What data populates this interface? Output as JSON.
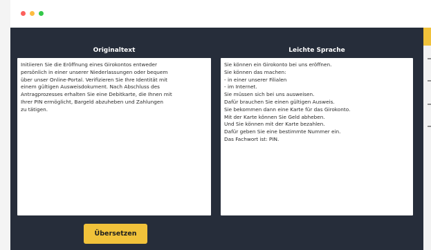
{
  "window": {
    "controls": [
      "close",
      "minimize",
      "maximize"
    ],
    "colors": {
      "close": "#fc605c",
      "minimize": "#fdbc40",
      "maximize": "#34c84a"
    }
  },
  "original": {
    "title": "Originaltext",
    "lines": [
      "Initiieren Sie die Eröffnung eines Girokontos entweder",
      "persönlich in einer unserer Niederlassungen oder bequem",
      "über unser Online-Portal. Verifizieren Sie Ihre Identität mit",
      "einem gültigen Ausweisdokument. Nach Abschluss des",
      "Antragprozesses erhalten Sie eine Debitkarte, die Ihnen mit",
      "Ihrer PIN ermöglicht, Bargeld abzuheben und Zahlungen",
      "zu tätigen."
    ]
  },
  "simple": {
    "title": "Leichte Sprache",
    "lines": [
      "Sie können ein Girokonto bei uns eröffnen.",
      "Sie können das machen:",
      "- in einer unserer Filialen",
      "- im Internet.",
      "Sie müssen sich bei uns ausweisen.",
      "Dafür brauchen Sie einen gültigen Ausweis.",
      "Sie bekommen dann eine Karte für das Girokonto.",
      "Mit der Karte können Sie Geld abheben.",
      "Und Sie können mit der Karte bezahlen.",
      "Dafür geben Sie eine bestimmte Nummer ein.",
      "Das Fachwort ist: PIN."
    ]
  },
  "translate_button": {
    "label": "Übersetzen",
    "color": "#f1c23a"
  },
  "theme": {
    "panel_bg": "#262d3a",
    "text_area_bg": "#ffffff"
  }
}
